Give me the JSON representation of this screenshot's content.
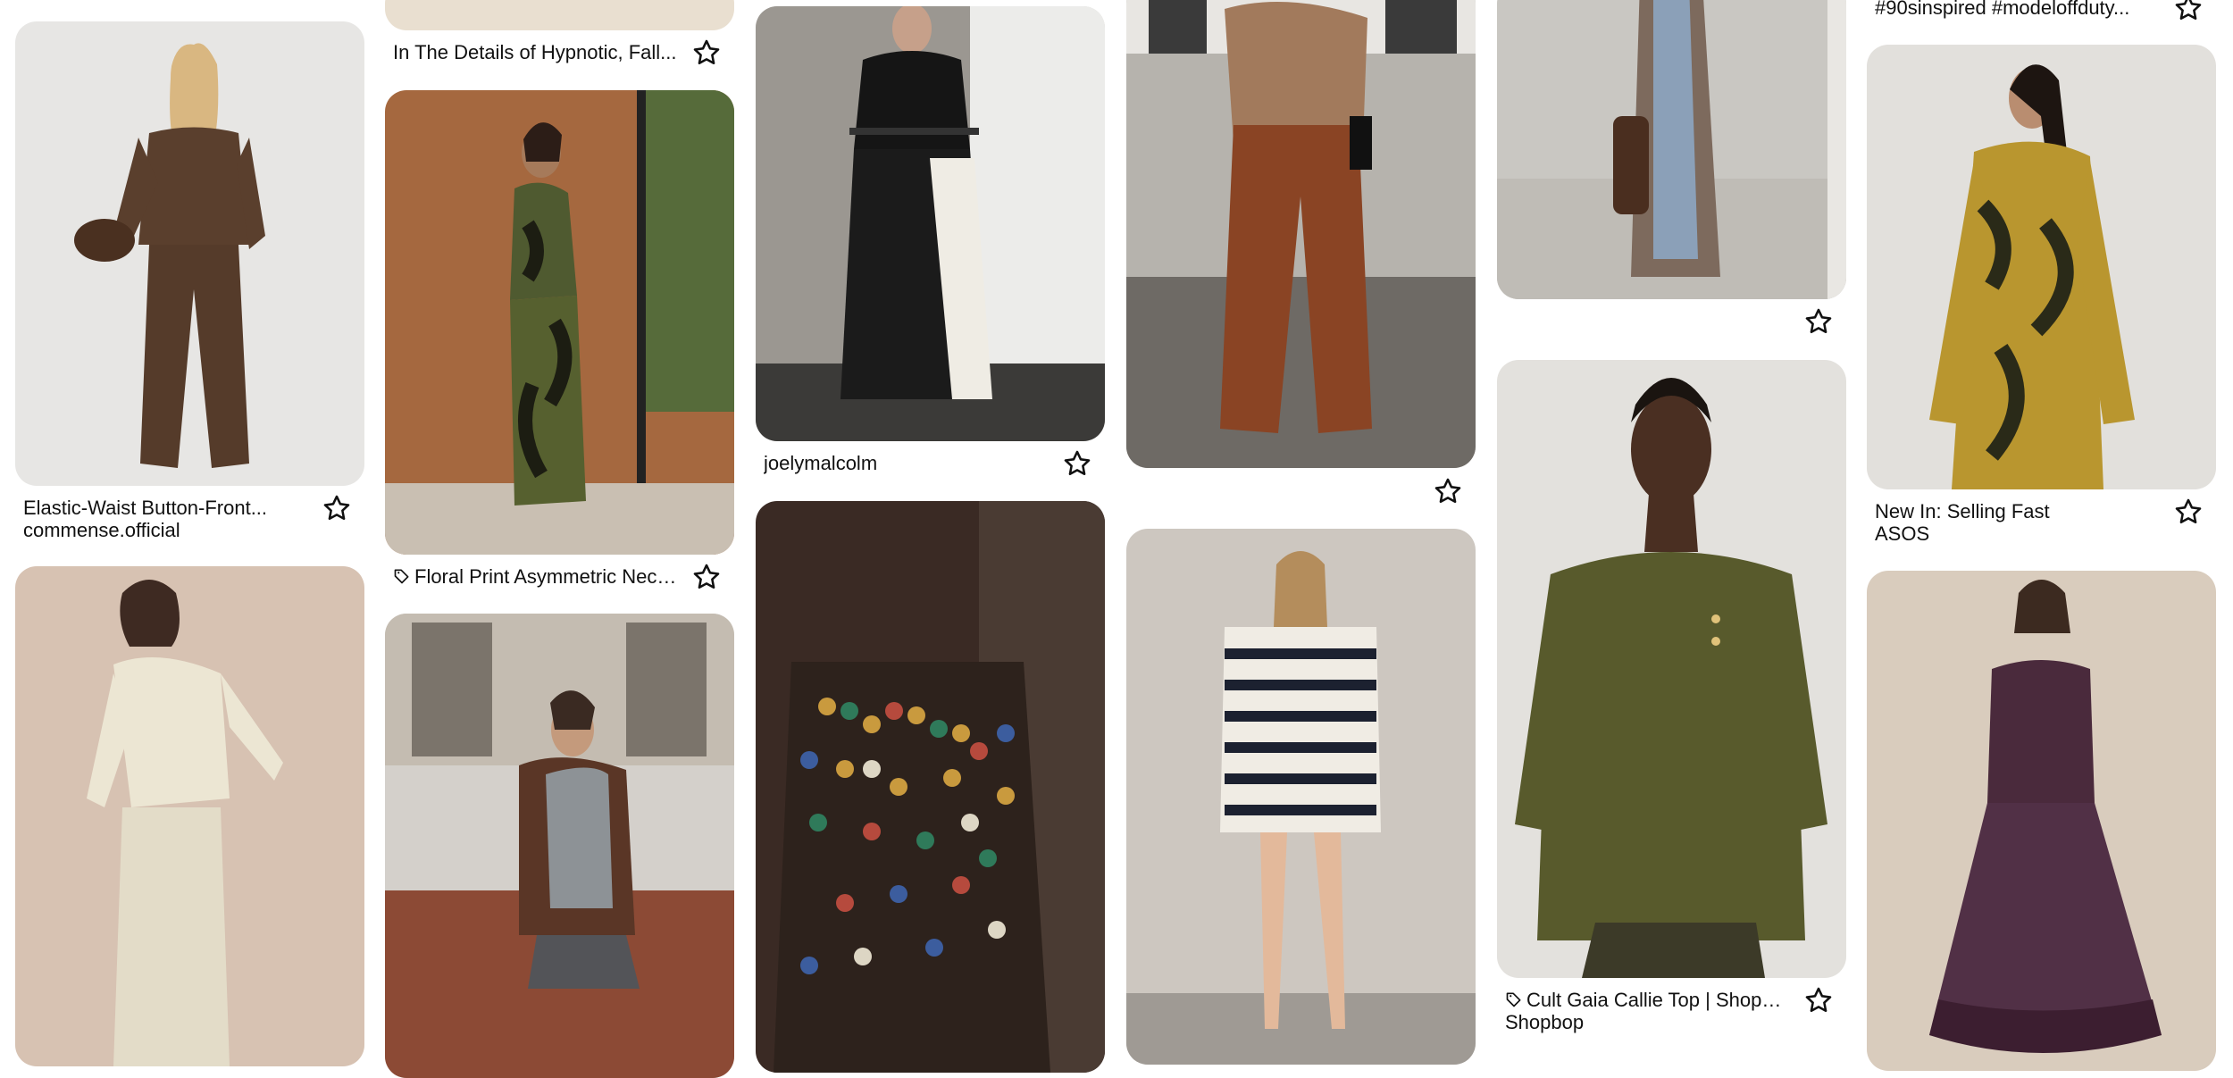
{
  "colors": {
    "background": "#ffffff",
    "text": "#111111",
    "card_radius_hint": "rounded"
  },
  "icons": {
    "save": "star-icon",
    "product": "tag-icon"
  },
  "pins": {
    "c1p1": {
      "title": "Elastic-Waist Button-Front...",
      "subtitle": "commense.official"
    },
    "c2p0": {
      "title": "In The Details of Hypnotic, Fall..."
    },
    "c2p1": {
      "title": "Floral Print Asymmetric Neck...",
      "product": true
    },
    "c3p1": {
      "title": "joelymalcolm"
    },
    "c5p1": {
      "title": "Cult Gaia Callie Top | Shopbop",
      "subtitle": "Shopbop",
      "product": true
    },
    "c6p0": {
      "title": "#90sinspired #modeloffduty..."
    },
    "c6p1": {
      "title": "New In: Selling Fast",
      "subtitle": "ASOS"
    }
  }
}
